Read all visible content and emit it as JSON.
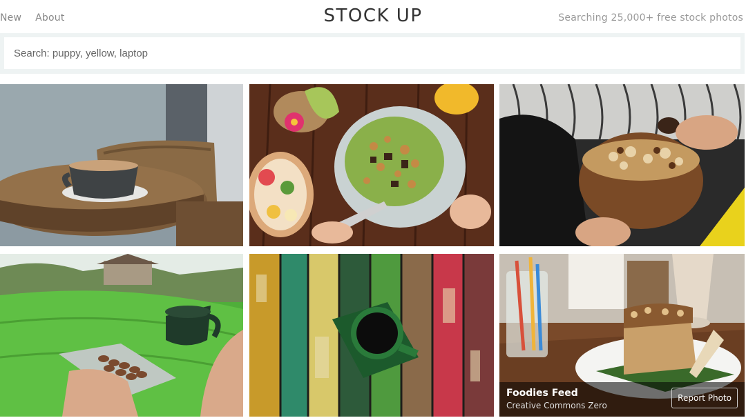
{
  "nav": {
    "items": [
      {
        "label": "New"
      },
      {
        "label": "About"
      }
    ]
  },
  "header": {
    "title": "STOCK UP",
    "tagline": "Searching 25,000+ free stock photos"
  },
  "search": {
    "placeholder": "Search: puppy, yellow, laptop",
    "value": ""
  },
  "photos": [
    {
      "subject": "coffee cup on wooden table"
    },
    {
      "subject": "smoothie bowl and fruit plate"
    },
    {
      "subject": "granola coconut bowl"
    },
    {
      "subject": "hand holding green cup over rice field"
    },
    {
      "subject": "green cup on painted wood"
    },
    {
      "subject": "cake and milkshake",
      "overlay": {
        "title": "Foodies Feed",
        "license": "Creative Commons Zero",
        "report_label": "Report Photo"
      }
    }
  ]
}
